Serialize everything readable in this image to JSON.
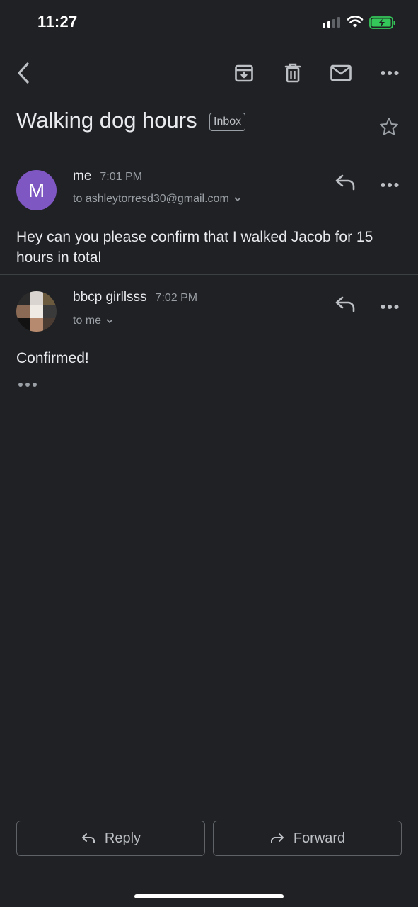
{
  "status_bar": {
    "time": "11:27",
    "signal_icon": "signal-icon",
    "wifi_icon": "wifi-icon",
    "battery_icon": "battery-charging-icon"
  },
  "toolbar": {
    "back_icon": "back-chevron-icon",
    "archive_icon": "archive-icon",
    "delete_icon": "trash-icon",
    "mark_unread_icon": "mail-icon",
    "more_icon": "more-horizontal-icon"
  },
  "thread": {
    "subject": "Walking dog hours",
    "label": "Inbox",
    "star_icon": "star-outline-icon"
  },
  "messages": [
    {
      "avatar_letter": "M",
      "avatar_color": "#7e57c2",
      "sender": "me",
      "time": "7:01 PM",
      "recipient": "to ashleytorresd30@gmail.com",
      "body": "Hey can you please confirm that I walked Jacob for 15 hours in total"
    },
    {
      "sender": "bbcp girllsss",
      "time": "7:02 PM",
      "recipient": "to me",
      "body": "Confirmed!"
    }
  ],
  "actions": {
    "reply_label": "Reply",
    "forward_label": "Forward"
  },
  "colors": {
    "background": "#202124",
    "text": "#e8eaed",
    "secondary_text": "#9aa0a6",
    "border": "#5f6368",
    "battery_green": "#34c759"
  }
}
